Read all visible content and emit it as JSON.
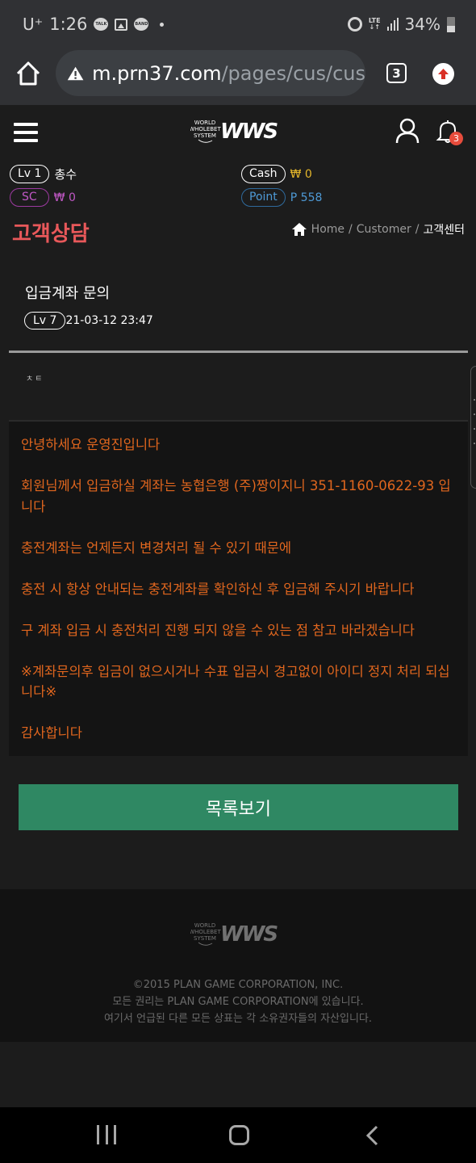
{
  "status_bar": {
    "carrier": "U⁺",
    "time": "1:26",
    "notifications": [
      "kakaotalk-icon",
      "gallery-icon",
      "band-icon"
    ],
    "talk_label": "TALK",
    "band_label": "BAND",
    "network": "LTE",
    "battery": "34%"
  },
  "browser": {
    "url_host": "m.prn37.com",
    "url_path": "/pages/cus/cus",
    "tab_count": "3"
  },
  "header": {
    "logo_small": [
      "WORLD",
      "WHOLEBET",
      "SYSTEM"
    ],
    "logo_big": "WWS",
    "notification_count": "3"
  },
  "user": {
    "level_label": "Lv 1",
    "nickname": "총수",
    "cash_label": "Cash",
    "cash_value": "₩ 0",
    "sc_label": "SC",
    "sc_value": "₩ 0",
    "point_label": "Point",
    "point_value": "P 558"
  },
  "page": {
    "title": "고객상담",
    "breadcrumb": [
      {
        "label": "Home"
      },
      {
        "label": "Customer"
      },
      {
        "label": "고객센터"
      }
    ],
    "breadcrumb_sep": "/"
  },
  "post": {
    "title": "입금계좌 문의",
    "level": "Lv 7",
    "datetime": "21-03-12 23:47",
    "question": "ㅊㅌ",
    "answer": [
      "안녕하세요 운영진입니다",
      "회원님께서 입금하실 계좌는 농협은행 (주)짱이지니 351-1160-0622-93 입니다",
      "충전계좌는 언제든지 변경처리 될 수 있기 때문에",
      "충전 시 항상 안내되는 충전계좌를 확인하신 후 입금해 주시기 바랍니다",
      "구 계좌 입금 시 충전처리 진행 되지 않을 수 있는 점 참고 바라겠습니다",
      "※계좌문의후 입금이 없으시거나 수표 입금시 경고없이 아이디 정지 처리 되십니다※",
      "감사합니다"
    ]
  },
  "actions": {
    "list_button": "목록보기"
  },
  "footer": {
    "lines": [
      "©2015 PLAN GAME CORPORATION, INC.",
      "모든 권리는 PLAN GAME CORPORATION에 있습니다.",
      "여기서 언급된 다른 모든 상표는 각 소유권자들의 자산입니다."
    ]
  },
  "colors": {
    "accent_title": "#e8585a",
    "answer_text": "#e0661e",
    "button_green": "#2f8863",
    "cash": "#e4b62b",
    "sc": "#c158c6",
    "point": "#4e9ad6",
    "badge": "#e74c3c"
  }
}
